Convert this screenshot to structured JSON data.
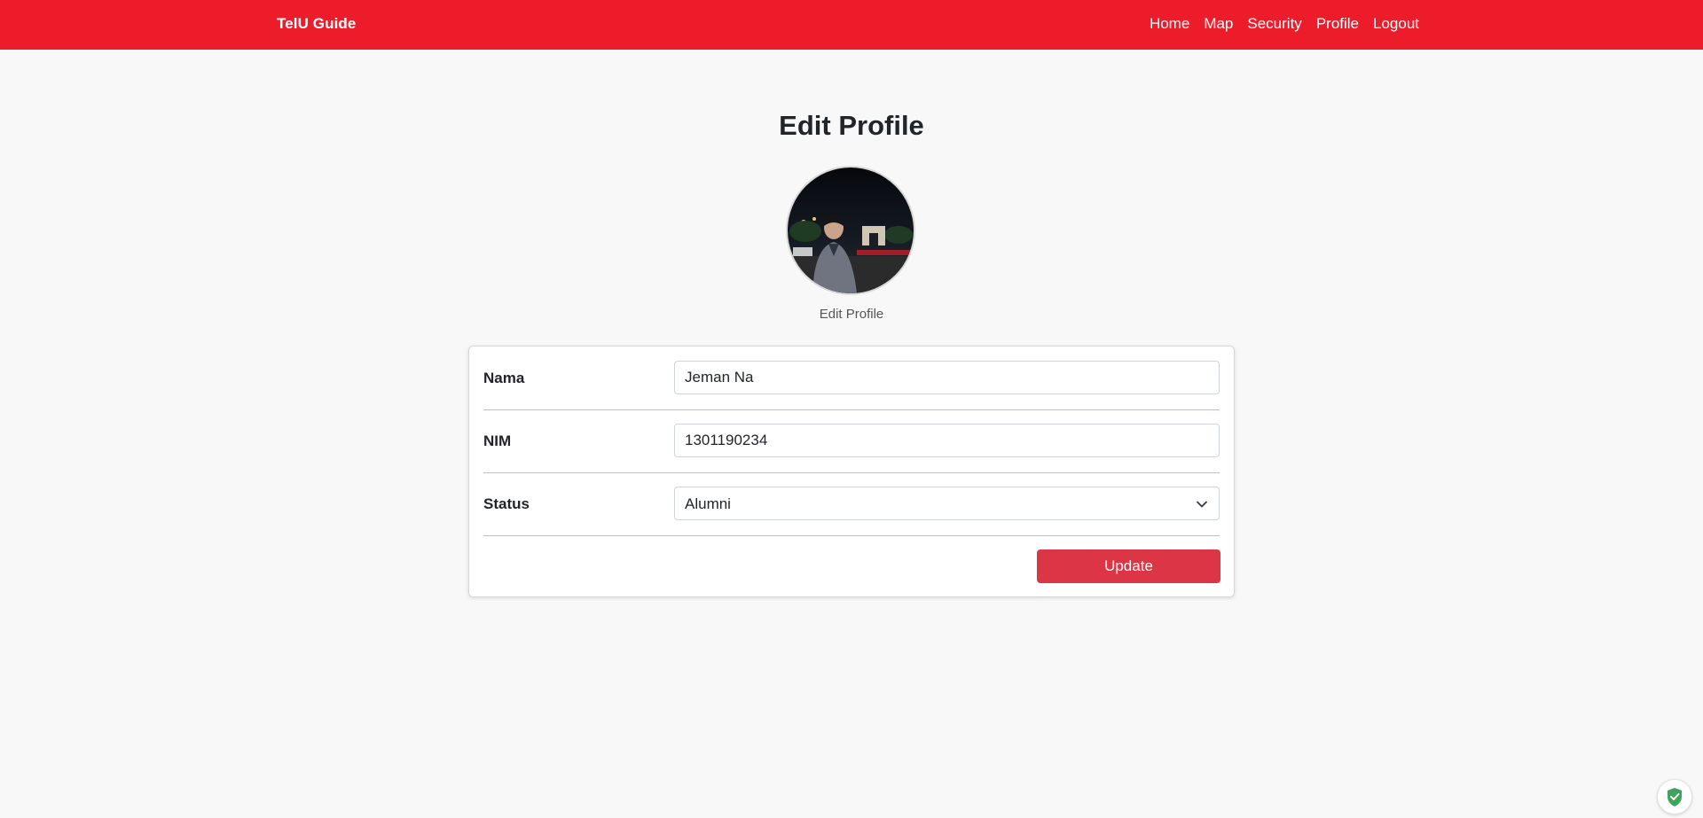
{
  "navbar": {
    "brand": "TelU Guide",
    "links": [
      "Home",
      "Map",
      "Security",
      "Profile",
      "Logout"
    ],
    "background_color": "#ed1c2b"
  },
  "page": {
    "title": "Edit Profile",
    "avatar_caption": "Edit Profile"
  },
  "form": {
    "nama": {
      "label": "Nama",
      "value": "Jeman Na"
    },
    "nim": {
      "label": "NIM",
      "value": "1301190234"
    },
    "status": {
      "label": "Status",
      "value": "Alumni"
    },
    "update_label": "Update",
    "update_color": "#dc3545"
  },
  "icons": {
    "status_dropdown": "chevron-down-icon",
    "corner_badge": "shield-check-icon"
  }
}
